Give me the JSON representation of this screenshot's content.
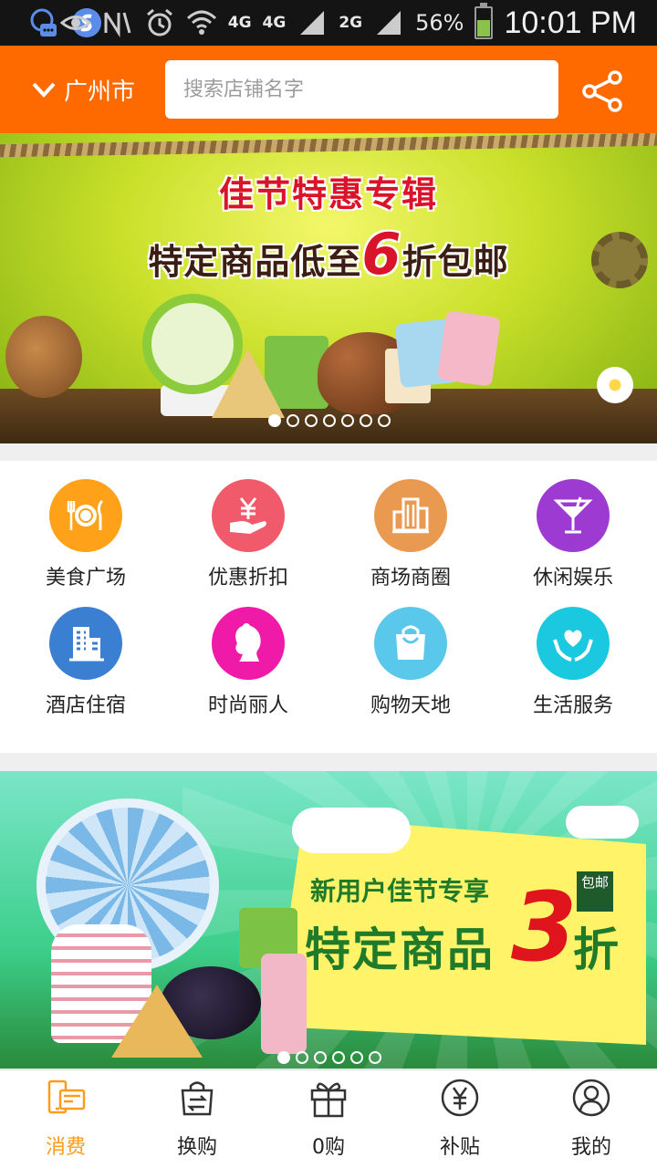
{
  "status_bar": {
    "network1": "4G",
    "network2": "4G",
    "network3": "2G",
    "battery_pct": "56%",
    "battery_level": 0.56,
    "time": "10:01 PM"
  },
  "header": {
    "city": "广州市",
    "search_placeholder": "搜索店铺名字",
    "bg_color": "#ff6a00"
  },
  "banner1": {
    "line1": "佳节特惠专辑",
    "line2_a": "特定商品低至",
    "line2_num": "6",
    "line2_b": "折包邮",
    "slides": 7,
    "active_slide": 0
  },
  "categories": [
    {
      "label": "美食广场",
      "icon": "plate-fork-knife-icon",
      "color": "#ffa21a"
    },
    {
      "label": "优惠折扣",
      "icon": "yen-hand-icon",
      "color": "#f05a6a"
    },
    {
      "label": "商场商圈",
      "icon": "building-icon",
      "color": "#ea9a50"
    },
    {
      "label": "休闲娱乐",
      "icon": "cocktail-icon",
      "color": "#9c3ad2"
    },
    {
      "label": "酒店住宿",
      "icon": "hotel-icon",
      "color": "#3a7fd2"
    },
    {
      "label": "时尚丽人",
      "icon": "woman-profile-icon",
      "color": "#f01aa8"
    },
    {
      "label": "购物天地",
      "icon": "shopping-bag-icon",
      "color": "#5ac8ea"
    },
    {
      "label": "生活服务",
      "icon": "heart-hands-icon",
      "color": "#1ac8e0"
    }
  ],
  "banner2": {
    "subtitle": "新用户佳节专享",
    "main": "特定商品",
    "number": "3",
    "suffix": "折",
    "tag": "包邮",
    "slides": 6,
    "active_slide": 0
  },
  "tabs": [
    {
      "label": "消费",
      "icon": "phone-card-icon",
      "active": true
    },
    {
      "label": "换购",
      "icon": "exchange-bag-icon",
      "active": false
    },
    {
      "label": "0购",
      "icon": "gift-icon",
      "active": false
    },
    {
      "label": "补贴",
      "icon": "yen-circle-icon",
      "active": false
    },
    {
      "label": "我的",
      "icon": "user-circle-icon",
      "active": false
    }
  ],
  "accent_color": "#ff9b1a"
}
